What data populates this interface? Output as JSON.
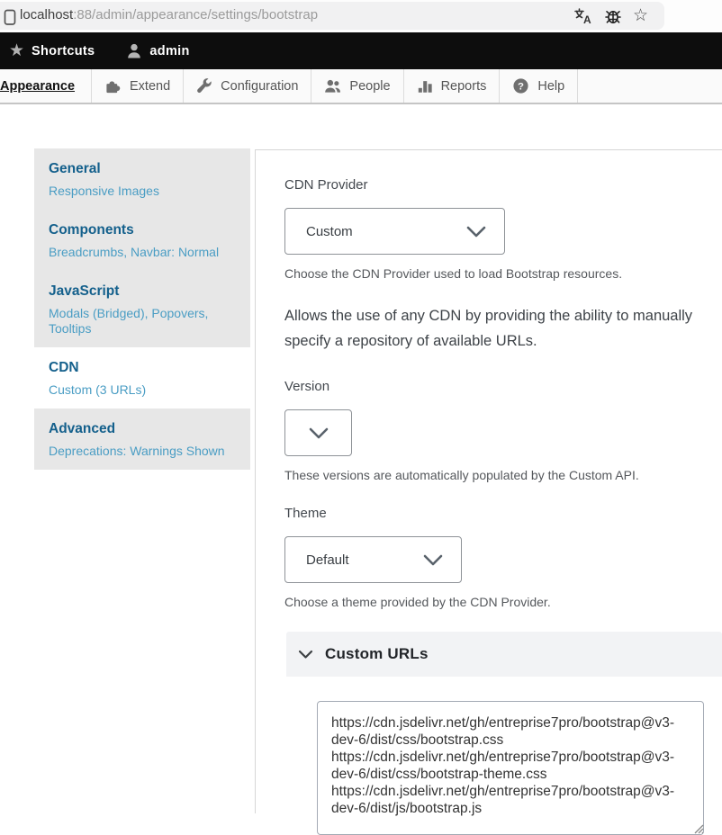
{
  "browser": {
    "url_host": "localhost",
    "url_path": ":88/admin/appearance/settings/bootstrap"
  },
  "admin_toolbar": {
    "shortcuts": "Shortcuts",
    "user": "admin"
  },
  "menu_bar": {
    "items": [
      {
        "label": "Appearance"
      },
      {
        "label": "Extend"
      },
      {
        "label": "Configuration"
      },
      {
        "label": "People"
      },
      {
        "label": "Reports"
      },
      {
        "label": "Help"
      }
    ]
  },
  "sidebar": {
    "items": [
      {
        "title": "General",
        "summary": "Responsive Images"
      },
      {
        "title": "Components",
        "summary": "Breadcrumbs, Navbar: Normal"
      },
      {
        "title": "JavaScript",
        "summary": "Modals (Bridged), Popovers, Tooltips"
      },
      {
        "title": "CDN",
        "summary": "Custom (3 URLs)"
      },
      {
        "title": "Advanced",
        "summary": "Deprecations: Warnings Shown"
      }
    ]
  },
  "form": {
    "cdn_provider": {
      "label": "CDN Provider",
      "value": "Custom",
      "description": "Choose the CDN Provider used to load Bootstrap resources."
    },
    "intro": "Allows the use of any CDN by providing the ability to manually specify a repository of available URLs.",
    "version": {
      "label": "Version",
      "value": "",
      "description": "These versions are automatically populated by the Custom API."
    },
    "theme": {
      "label": "Theme",
      "value": "Default",
      "description": "Choose a theme provided by the CDN Provider."
    },
    "custom_urls": {
      "title": "Custom URLs",
      "value": "https://cdn.jsdelivr.net/gh/entreprise7pro/bootstrap@v3-dev-6/dist/css/bootstrap.css\nhttps://cdn.jsdelivr.net/gh/entreprise7pro/bootstrap@v3-dev-6/dist/css/bootstrap-theme.css\nhttps://cdn.jsdelivr.net/gh/entreprise7pro/bootstrap@v3-dev-6/dist/js/bootstrap.js"
    }
  },
  "colors": {
    "toolbar_bg": "#0d0d0d",
    "sidebar_bg": "#e7e7e7",
    "sidebar_heading": "#14608c",
    "sidebar_summary": "#4a9dc4",
    "select_border": "#8e9297",
    "details_header_bg": "#f2f3f5"
  }
}
